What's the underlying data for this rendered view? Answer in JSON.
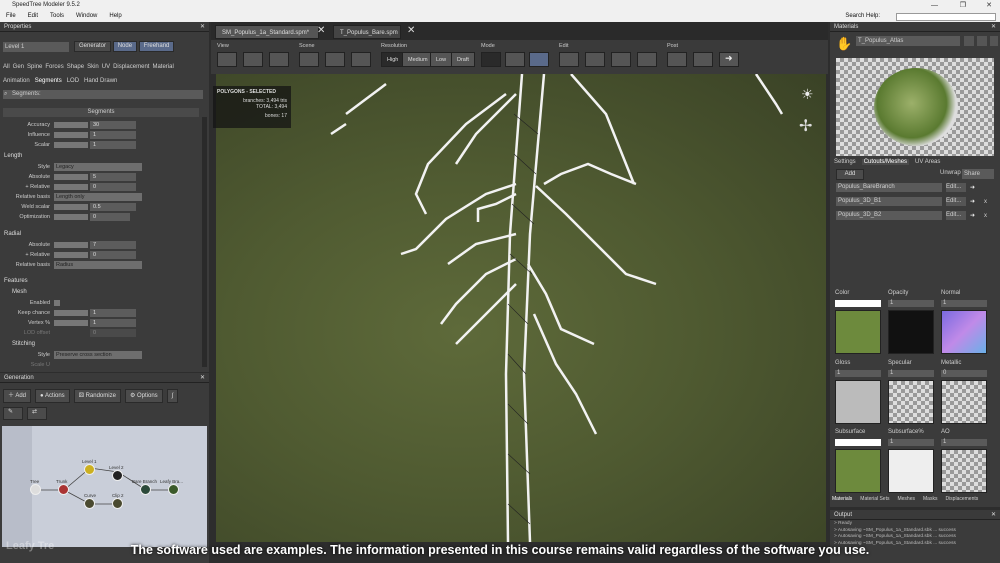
{
  "app": {
    "title": "SpeedTree Modeler 9.5.2"
  },
  "menu": [
    "File",
    "Edit",
    "Tools",
    "Window",
    "Help"
  ],
  "search_label": "Search Help:",
  "properties": {
    "title": "Properties",
    "level": "Level 1",
    "mode_buttons": [
      "Generator",
      "Node",
      "Freehand"
    ],
    "tabs_row1": [
      "All",
      "Gen",
      "Spine",
      "Forces",
      "Shape",
      "Skin",
      "UV",
      "Displacement",
      "Material"
    ],
    "tabs_row2": [
      "Animation",
      "Segments",
      "LOD",
      "Hand Drawn"
    ],
    "filter": "Segments:",
    "section_segments": "Segments",
    "accuracy": {
      "label": "Accuracy",
      "value": "30"
    },
    "influence": {
      "label": "Influence",
      "value": "1"
    },
    "scalar": {
      "label": "Scalar",
      "value": "1"
    },
    "length_header": "Length",
    "style": {
      "label": "Style",
      "value": "Legacy"
    },
    "absolute": {
      "label": "Absolute",
      "value": "5"
    },
    "plus_relative": {
      "label": "+ Relative",
      "value": "0"
    },
    "relative_basis": {
      "label": "Relative basis",
      "value": "Length only"
    },
    "weld_scalar": {
      "label": "Weld scalar",
      "value": "0.5"
    },
    "optimization": {
      "label": "Optimization",
      "value": "0"
    },
    "radial_header": "Radial",
    "r_absolute": {
      "label": "Absolute",
      "value": "7"
    },
    "r_plus_relative": {
      "label": "+ Relative",
      "value": "0"
    },
    "r_relative_basis": {
      "label": "Relative basis",
      "value": "Radius"
    },
    "features_header": "Features",
    "mesh_header": "Mesh",
    "enabled": {
      "label": "Enabled"
    },
    "keep_chance": {
      "label": "Keep chance",
      "value": "1"
    },
    "vertex_pct": {
      "label": "Vertex %",
      "value": "1"
    },
    "lod_offset": {
      "label": "LOD offset",
      "value": "0"
    },
    "stitching_header": "Stitching",
    "stitch_style": {
      "label": "Style",
      "value": "Preserve cross section"
    },
    "scale_u": {
      "label": "Scale U"
    }
  },
  "generation": {
    "title": "Generation",
    "buttons": [
      "Add",
      "Actions",
      "Randomize",
      "Options"
    ],
    "nodes": [
      "Tree",
      "Trunk",
      "Level 1",
      "Level 2",
      "Bare Branch",
      "Leafy Bra...",
      "Curve",
      "Clip 2"
    ]
  },
  "viewport": {
    "tabs": [
      "SM_Populus_1a_Standard.spm*",
      "T_Populus_Bare.spm"
    ],
    "groups": [
      "View",
      "Scene",
      "Resolution",
      "Mode",
      "Edit",
      "Post"
    ],
    "resolution": [
      "High",
      "Medium",
      "Low",
      "Draft"
    ],
    "polygons_selected": "POLYGONS - SELECTED",
    "branches": "branches: 3,494 tris",
    "total": "TOTAL: 3,494",
    "bones": "bones: 17"
  },
  "materials": {
    "title": "Materials",
    "name": "T_Populus_Atlas",
    "tabs": [
      "Settings",
      "Cutouts/Meshes",
      "UV Areas"
    ],
    "add": "Add",
    "unwrap": "Unwrap",
    "share": "Share",
    "meshes": [
      "Populus_BareBranch",
      "Populus_3D_B1",
      "Populus_3D_B2"
    ],
    "edit": "Edit...",
    "slots": [
      "Color",
      "Opacity",
      "Normal",
      "Gloss",
      "Specular",
      "Metallic",
      "Subsurface",
      "Subsurface%",
      "AO"
    ],
    "slot_values": [
      "1",
      "1",
      "1",
      "1",
      "1",
      "0",
      "1",
      "1",
      "1"
    ],
    "bottom_tabs": [
      "Materials",
      "Material Sets",
      "Meshes",
      "Masks",
      "Displacements"
    ]
  },
  "output": {
    "title": "Output",
    "lines": [
      "> Ready",
      "> Autosaving ~SM_Populus_1a_Standard.sbk ... success",
      "> Autosaving ~SM_Populus_1a_Standard.sbk ... success",
      "> Autosaving ~SM_Populus_1a_Standard.sbk ... success"
    ]
  },
  "subtitle": "The software used are examples. The information presented in this course remains valid regardless of the software you use.",
  "watermark": "Leafy Tre",
  "colors": {
    "viewport": "#4f5a31",
    "accent": "#5a6a8a"
  }
}
